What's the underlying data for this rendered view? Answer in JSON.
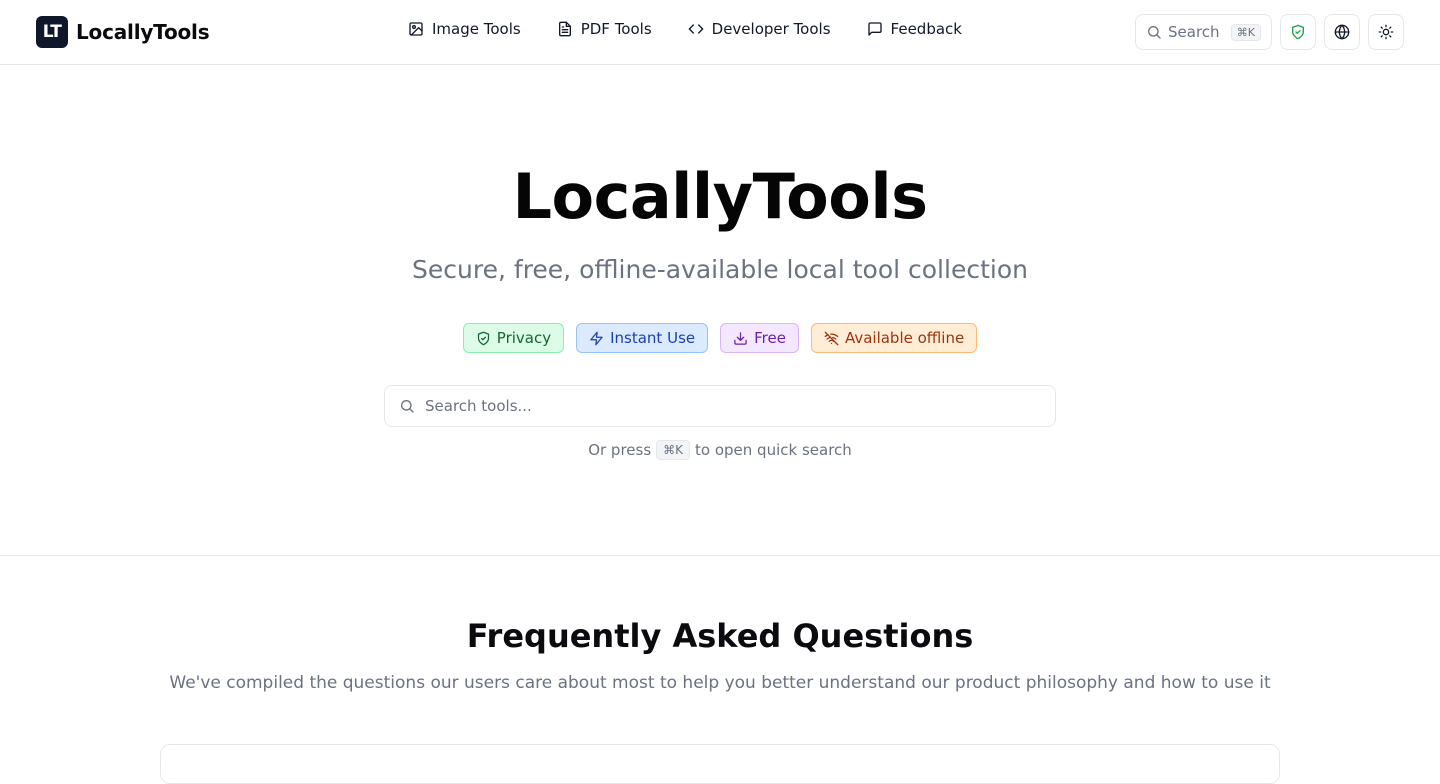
{
  "header": {
    "logo_mark": "LT",
    "logo_text": "LocallyTools",
    "nav": [
      {
        "label": "Image Tools",
        "icon": "image-icon"
      },
      {
        "label": "PDF Tools",
        "icon": "file-text-icon"
      },
      {
        "label": "Developer Tools",
        "icon": "code-icon"
      },
      {
        "label": "Feedback",
        "icon": "message-square-icon"
      }
    ],
    "search_label": "Search",
    "search_shortcut": "⌘K",
    "actions": [
      "shield-check-icon",
      "globe-icon",
      "sun-icon"
    ]
  },
  "hero": {
    "title": "LocallyTools",
    "subtitle": "Secure, free, offline-available local tool collection",
    "badges": [
      {
        "label": "Privacy",
        "icon": "shield-check-icon",
        "color": "#166534"
      },
      {
        "label": "Instant Use",
        "icon": "zap-icon",
        "color": "#1e40af"
      },
      {
        "label": "Free",
        "icon": "download-icon",
        "color": "#6b21a8"
      },
      {
        "label": "Available offline",
        "icon": "wifi-off-icon",
        "color": "#9a3412"
      }
    ],
    "search_placeholder": "Search tools...",
    "hint_prefix": "Or press",
    "hint_key": "⌘K",
    "hint_suffix": "to open quick search"
  },
  "faq": {
    "title": "Frequently Asked Questions",
    "subtitle": "We've compiled the questions our users care about most to help you better understand our product philosophy and how to use it"
  },
  "colors": {
    "accent_green": "#16a34a",
    "logo_bg": "#0f172a"
  }
}
